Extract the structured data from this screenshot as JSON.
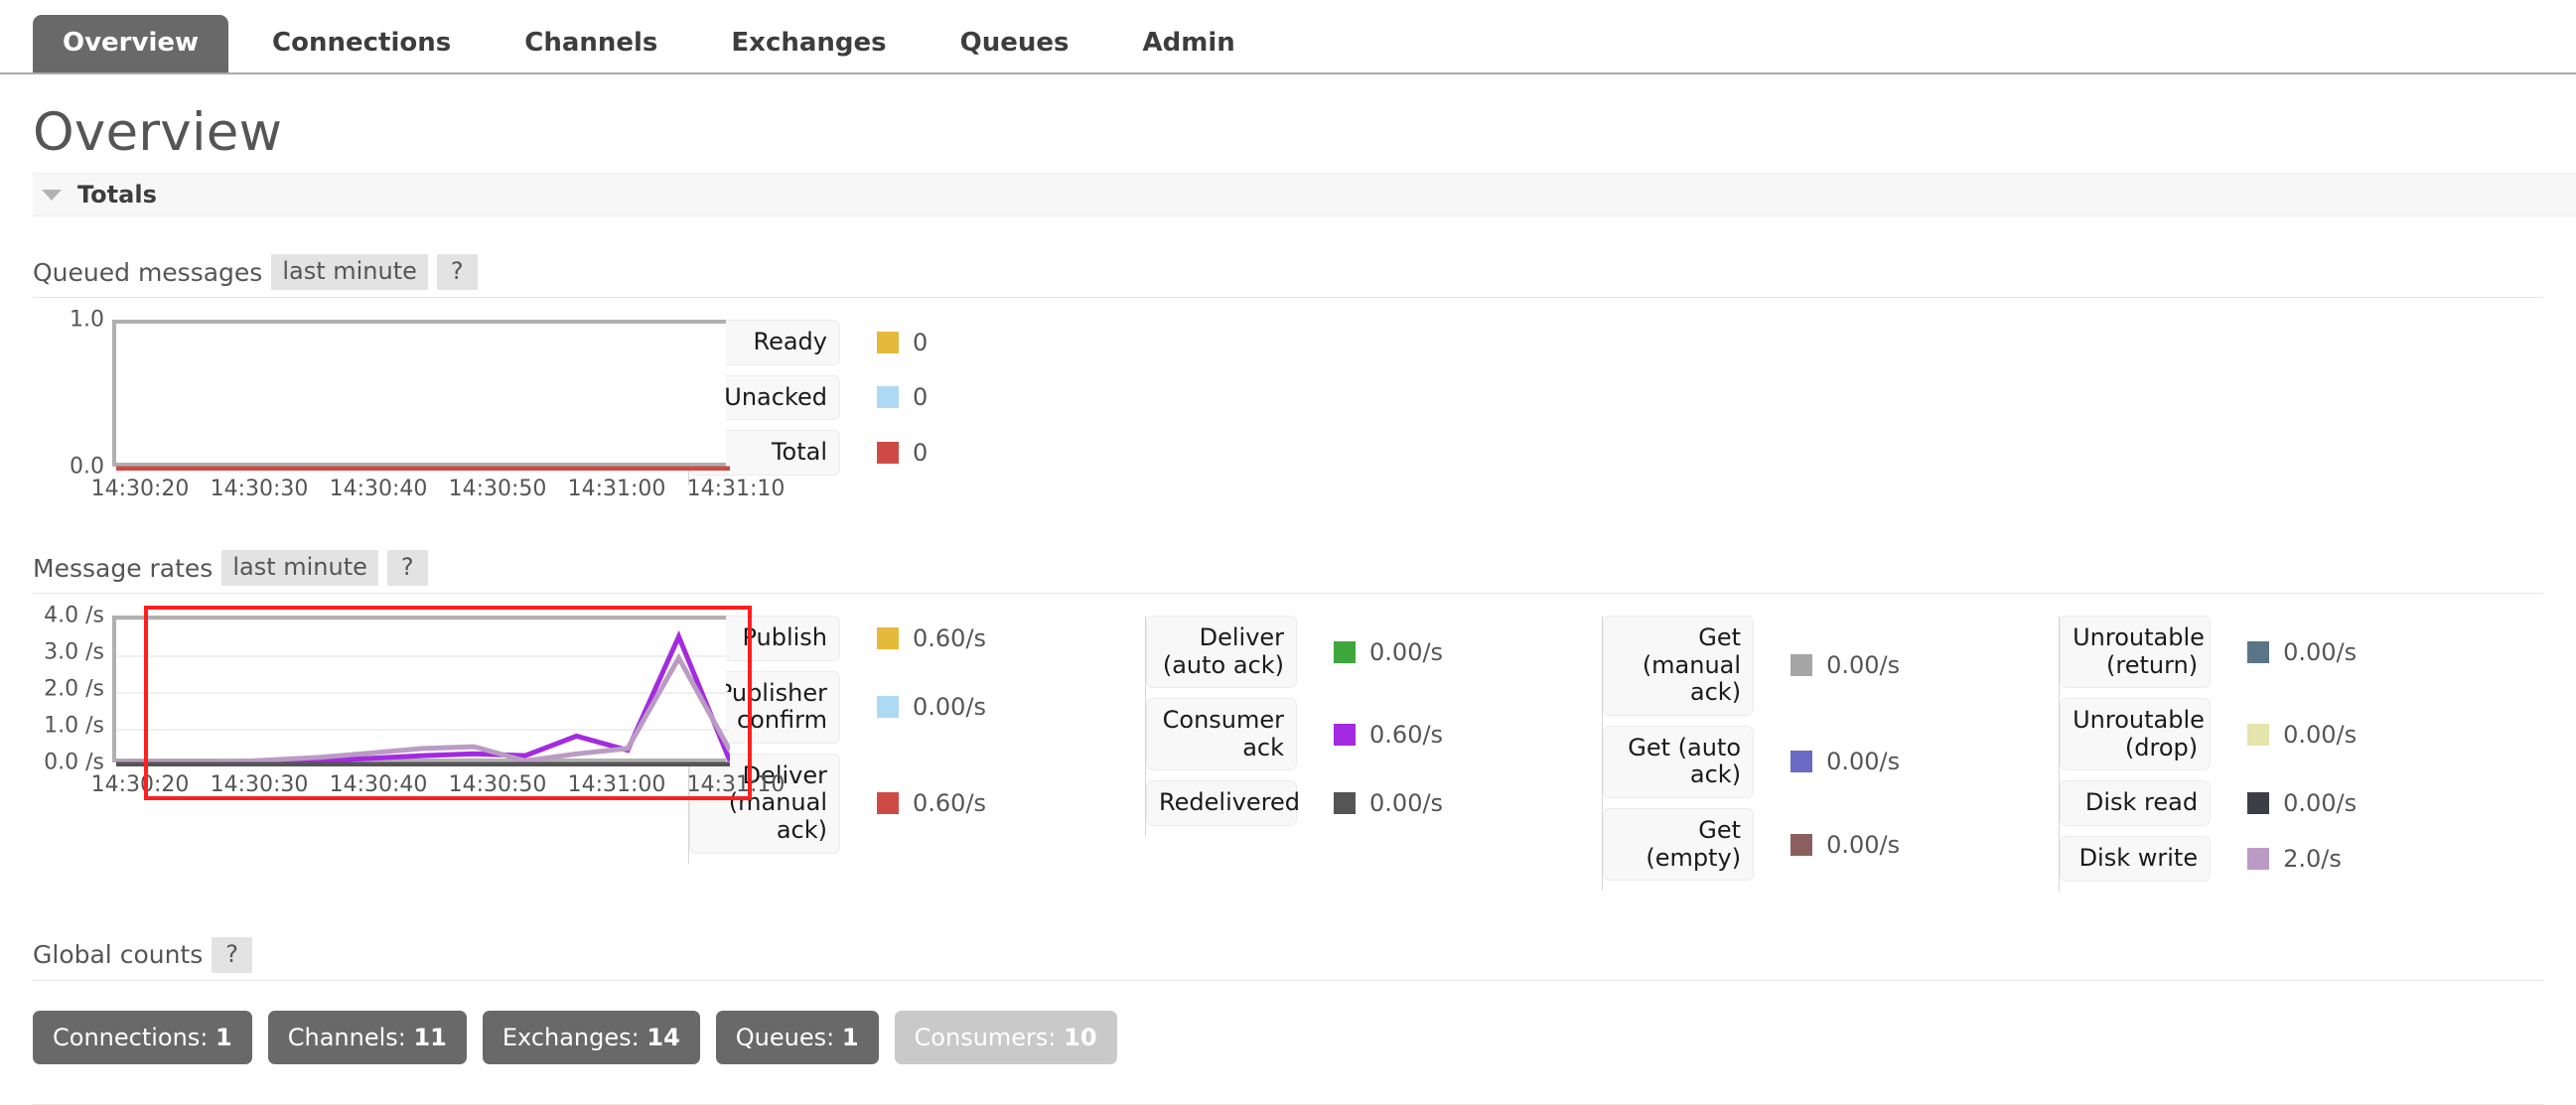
{
  "nav": {
    "tabs": [
      {
        "label": "Overview",
        "active": true
      },
      {
        "label": "Connections",
        "active": false
      },
      {
        "label": "Channels",
        "active": false
      },
      {
        "label": "Exchanges",
        "active": false
      },
      {
        "label": "Queues",
        "active": false
      },
      {
        "label": "Admin",
        "active": false
      }
    ]
  },
  "page": {
    "title": "Overview"
  },
  "totals": {
    "section_title": "Totals",
    "caret": "caret-down-icon"
  },
  "queued_messages": {
    "label": "Queued messages",
    "period": "last minute",
    "help": "?",
    "legend": [
      {
        "name": "Ready",
        "value": "0",
        "color": "#e5b93a"
      },
      {
        "name": "Unacked",
        "value": "0",
        "color": "#aed9f4"
      },
      {
        "name": "Total",
        "value": "0",
        "color": "#ce4b45"
      }
    ]
  },
  "message_rates": {
    "label": "Message rates",
    "period": "last minute",
    "help": "?",
    "legend_columns": [
      [
        {
          "name": "Publish",
          "value": "0.60/s",
          "color": "#e5b93a"
        },
        {
          "name": "Publisher\nconfirm",
          "value": "0.00/s",
          "color": "#aed9f4"
        },
        {
          "name": "Deliver\n(manual\nack)",
          "value": "0.60/s",
          "color": "#ce4b45"
        }
      ],
      [
        {
          "name": "Deliver\n(auto ack)",
          "value": "0.00/s",
          "color": "#3da63d"
        },
        {
          "name": "Consumer\nack",
          "value": "0.60/s",
          "color": "#a32ae0"
        },
        {
          "name": "Redelivered",
          "value": "0.00/s",
          "color": "#555555"
        }
      ],
      [
        {
          "name": "Get\n(manual\nack)",
          "value": "0.00/s",
          "color": "#a6a6a6"
        },
        {
          "name": "Get (auto\nack)",
          "value": "0.00/s",
          "color": "#6a6ac4"
        },
        {
          "name": "Get\n(empty)",
          "value": "0.00/s",
          "color": "#8c5f5f"
        }
      ],
      [
        {
          "name": "Unroutable\n(return)",
          "value": "0.00/s",
          "color": "#5a7586"
        },
        {
          "name": "Unroutable\n(drop)",
          "value": "0.00/s",
          "color": "#e5e5ad"
        },
        {
          "name": "Disk read",
          "value": "0.00/s",
          "color": "#3d3d45"
        },
        {
          "name": "Disk write",
          "value": "2.0/s",
          "color": "#bb9bc4"
        }
      ]
    ]
  },
  "global_counts": {
    "label": "Global counts",
    "help": "?",
    "buttons": [
      {
        "name": "Connections",
        "value": "1",
        "muted": false
      },
      {
        "name": "Channels",
        "value": "11",
        "muted": false
      },
      {
        "name": "Exchanges",
        "value": "14",
        "muted": false
      },
      {
        "name": "Queues",
        "value": "1",
        "muted": false
      },
      {
        "name": "Consumers",
        "value": "10",
        "muted": true
      }
    ]
  },
  "chart_data": [
    {
      "id": "queued-messages-chart",
      "type": "line",
      "title": "Queued messages",
      "xlabel": "",
      "ylabel": "",
      "ylim": [
        0.0,
        1.0
      ],
      "yticks": [
        "0.0",
        "1.0"
      ],
      "xticks": [
        "14:30:20",
        "14:30:30",
        "14:30:40",
        "14:30:50",
        "14:31:00",
        "14:31:10"
      ],
      "grid": false,
      "legend_position": "right",
      "series": [
        {
          "name": "Ready",
          "color": "#e5b93a",
          "values": [
            0,
            0,
            0,
            0,
            0,
            0
          ]
        },
        {
          "name": "Unacked",
          "color": "#aed9f4",
          "values": [
            0,
            0,
            0,
            0,
            0,
            0
          ]
        },
        {
          "name": "Total",
          "color": "#ce4b45",
          "values": [
            0,
            0,
            0,
            0,
            0,
            0
          ]
        }
      ]
    },
    {
      "id": "message-rates-chart",
      "type": "line",
      "title": "Message rates",
      "xlabel": "",
      "ylabel": "",
      "ylim": [
        0.0,
        4.0
      ],
      "yticks": [
        "0.0 /s",
        "1.0 /s",
        "2.0 /s",
        "3.0 /s",
        "4.0 /s"
      ],
      "xticks": [
        "14:30:20",
        "14:30:30",
        "14:30:40",
        "14:30:50",
        "14:31:00",
        "14:31:10"
      ],
      "grid": true,
      "legend_position": "right",
      "annotation": {
        "type": "highlight-rectangle",
        "color": "#ff1f1f"
      },
      "series": [
        {
          "name": "Consumer ack",
          "color": "#a32ae0",
          "x": [
            0,
            10,
            20,
            30,
            35,
            40,
            45,
            50,
            55,
            60
          ],
          "values": [
            0.05,
            0.05,
            0.1,
            0.25,
            0.3,
            0.25,
            0.8,
            0.4,
            3.6,
            0.1
          ]
        },
        {
          "name": "Disk write",
          "color": "#bb9bc4",
          "x": [
            0,
            10,
            20,
            30,
            35,
            40,
            45,
            50,
            55,
            60
          ],
          "values": [
            0.05,
            0.05,
            0.2,
            0.45,
            0.5,
            0.1,
            0.3,
            0.45,
            3.0,
            0.4
          ]
        },
        {
          "name": "Redelivered",
          "color": "#555555",
          "x": [
            0,
            10,
            20,
            30,
            40,
            50,
            60
          ],
          "values": [
            0,
            0,
            0,
            0,
            0,
            0,
            0
          ]
        }
      ]
    }
  ]
}
